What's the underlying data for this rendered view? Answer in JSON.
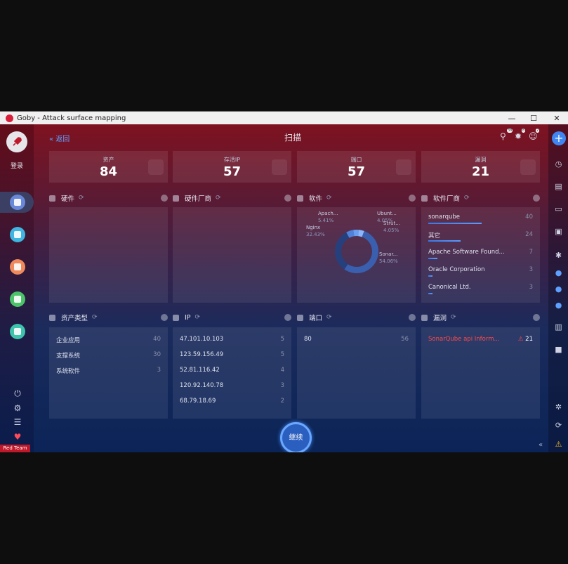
{
  "window": {
    "title": "Goby - Attack surface mapping",
    "min": "—",
    "max": "☐",
    "close": "✕"
  },
  "left": {
    "login": "登录",
    "red_team": "Red Team"
  },
  "header": {
    "back_label": "返回",
    "page_title": "扫描",
    "badges": [
      "38",
      "8",
      "2"
    ]
  },
  "stats": [
    {
      "label": "资产",
      "value": "84"
    },
    {
      "label": "存活IP",
      "value": "57"
    },
    {
      "label": "端口",
      "value": "57"
    },
    {
      "label": "漏洞",
      "value": "21"
    }
  ],
  "panels": {
    "hardware": {
      "title": "硬件"
    },
    "hardware_vendor": {
      "title": "硬件厂商"
    },
    "software": {
      "title": "软件"
    },
    "software_vendor": {
      "title": "软件厂商"
    },
    "asset_type": {
      "title": "资产类型"
    },
    "ip": {
      "title": "IP"
    },
    "port": {
      "title": "端口"
    },
    "vuln": {
      "title": "漏洞"
    }
  },
  "software_pie": [
    {
      "name": "Sonar...",
      "pct": "54.06%",
      "value": 54.06,
      "color": "#3a5fae"
    },
    {
      "name": "Nginx",
      "pct": "32.43%",
      "value": 32.43,
      "color": "#26407e"
    },
    {
      "name": "Apach...",
      "pct": "5.41%",
      "value": 5.41,
      "color": "#4f82db"
    },
    {
      "name": "Ubunt...",
      "pct": "4.05%",
      "value": 4.05,
      "color": "#6a9ef0"
    },
    {
      "name": "Strut...",
      "pct": "4.05%",
      "value": 4.05,
      "color": "#8ab8ff"
    }
  ],
  "software_vendors": [
    {
      "name": "sonarqube",
      "count": "40",
      "ratio": 1.0
    },
    {
      "name": "其它",
      "count": "24",
      "ratio": 0.6
    },
    {
      "name": "Apache Software Found...",
      "count": "7",
      "ratio": 0.175
    },
    {
      "name": "Oracle Corporation",
      "count": "3",
      "ratio": 0.075
    },
    {
      "name": "Canonical Ltd.",
      "count": "3",
      "ratio": 0.075
    }
  ],
  "asset_types": [
    {
      "name": "企业应用",
      "count": "40"
    },
    {
      "name": "支撑系统",
      "count": "30"
    },
    {
      "name": "系统软件",
      "count": "3"
    }
  ],
  "ips": [
    {
      "name": "47.101.10.103",
      "count": "5"
    },
    {
      "name": "123.59.156.49",
      "count": "5"
    },
    {
      "name": "52.81.116.42",
      "count": "4"
    },
    {
      "name": "120.92.140.78",
      "count": "3"
    },
    {
      "name": "68.79.18.69",
      "count": "2"
    }
  ],
  "ports": [
    {
      "name": "80",
      "count": "56"
    }
  ],
  "vulns": [
    {
      "name": "SonarQube api Inform...",
      "count": "21"
    }
  ],
  "continue_label": "继续"
}
